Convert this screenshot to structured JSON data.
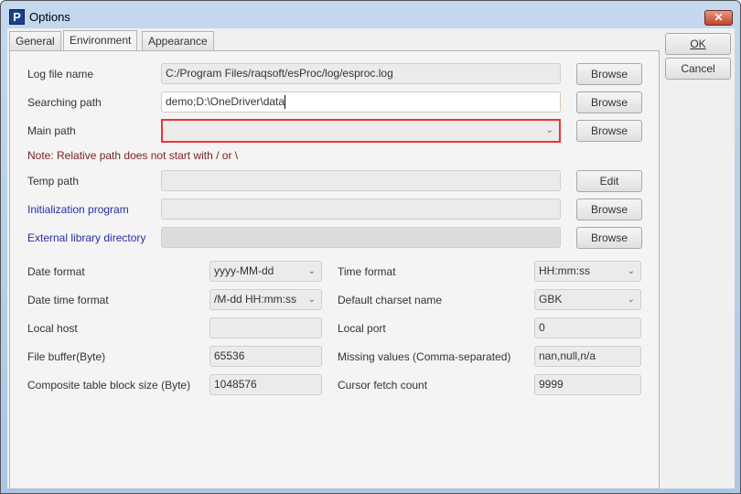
{
  "window": {
    "title": "Options",
    "icon": "P",
    "close": "✕"
  },
  "tabs": [
    {
      "label": "General"
    },
    {
      "label": "Environment"
    },
    {
      "label": "Appearance"
    }
  ],
  "buttons": {
    "ok": "OK",
    "cancel": "Cancel",
    "browse": "Browse",
    "edit": "Edit"
  },
  "paths": {
    "log_file": {
      "label": "Log file name",
      "value": "C:/Program Files/raqsoft/esProc/log/esproc.log"
    },
    "search": {
      "label": "Searching path",
      "value": "demo;D:\\OneDriver\\data"
    },
    "main": {
      "label": "Main path",
      "value": ""
    },
    "note": "Note: Relative path does not start with / or \\",
    "temp": {
      "label": "Temp path",
      "value": ""
    },
    "init": {
      "label": "Initialization program",
      "value": ""
    },
    "extlib": {
      "label": "External library directory",
      "value": ""
    }
  },
  "settings": {
    "date_format": {
      "label": "Date format",
      "value": "yyyy-MM-dd"
    },
    "time_format": {
      "label": "Time format",
      "value": "HH:mm:ss"
    },
    "datetime_format": {
      "label": "Date time format",
      "value": "/M-dd HH:mm:ss"
    },
    "charset": {
      "label": "Default charset name",
      "value": "GBK"
    },
    "local_host": {
      "label": "Local host",
      "value": ""
    },
    "local_port": {
      "label": "Local port",
      "value": "0"
    },
    "file_buffer": {
      "label": "File buffer(Byte)",
      "value": "65536"
    },
    "missing": {
      "label": "Missing values (Comma-separated)",
      "value": "nan,null,n/a"
    },
    "block_size": {
      "label": "Composite table block size (Byte)",
      "value": "1048576"
    },
    "cursor_fetch": {
      "label": "Cursor fetch count",
      "value": "9999"
    }
  },
  "colors": {
    "highlight": "#ee3333",
    "link_label": "#2a2aa8",
    "note": "#7a1f1f"
  }
}
